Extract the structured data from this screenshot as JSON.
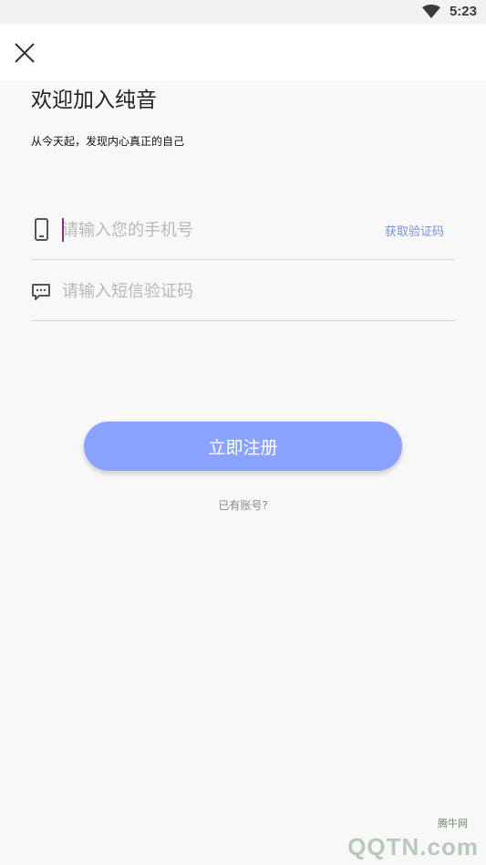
{
  "status_bar": {
    "time": "5:23",
    "wifi_icon": "wifi-icon"
  },
  "topbar": {
    "close_icon": "close-icon"
  },
  "welcome": {
    "title": "欢迎加入纯音",
    "subtitle": "从今天起，发现内心真正的自己"
  },
  "form": {
    "phone": {
      "icon": "phone-icon",
      "placeholder": "请输入您的手机号",
      "value": "",
      "get_code_label": "获取验证码"
    },
    "code": {
      "icon": "message-icon",
      "placeholder": "请输入短信验证码",
      "value": ""
    }
  },
  "register_button": {
    "label": "立即注册",
    "color": "#8aa3ff"
  },
  "has_account_link": "已有账号?",
  "watermark": {
    "site_label": "腾牛网",
    "brand_text": "QQTN.com"
  },
  "colors": {
    "accent": "#8aa3ff",
    "link": "#7d8fd6",
    "caret": "#8e2a7a"
  }
}
